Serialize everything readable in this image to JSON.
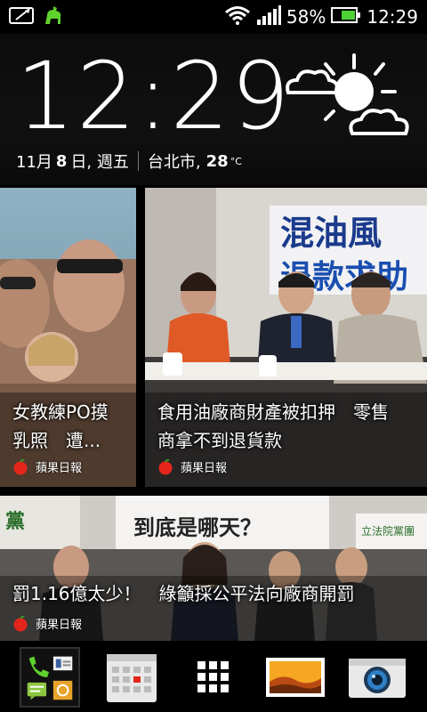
{
  "status_bar": {
    "battery_percent": "58%",
    "time": "12:29",
    "icons": [
      "photo-edit-icon",
      "android-mascot-icon",
      "wifi-icon",
      "signal-icon",
      "battery-icon"
    ]
  },
  "clock_widget": {
    "time": "12:29",
    "date_month": "11月",
    "date_day": "8",
    "date_suffix": "日, 週五",
    "city": "台北市,",
    "temperature": "28",
    "temp_unit": "°C",
    "weather_icon": "partly-sunny-cloudy-icon"
  },
  "news": {
    "tiles": [
      {
        "headline_line1": "女教練PO摸",
        "headline_line2": "乳照　遭...",
        "source": "蘋果日報"
      },
      {
        "headline_line1": "食用油廠商財產被扣押　零售",
        "headline_line2": "商拿不到退貨款",
        "source": "蘋果日報"
      },
      {
        "headline_line1": "罰1.16億太少！　綠籲採公平法向廠商開罰",
        "headline_line2": "",
        "source": "蘋果日報"
      }
    ],
    "photo_text": {
      "banner_line1": "混油風",
      "banner_line2": "退款求助",
      "banner_bottom": "到底是哪天？",
      "banner_side": "立法院黨團",
      "banner_left": "黨"
    }
  },
  "dock": {
    "items": [
      "people-messages-folder-icon",
      "calendar-icon",
      "all-apps-icon",
      "gallery-icon",
      "camera-icon"
    ]
  },
  "colors": {
    "accent_green": "#5fd12c",
    "battery_green": "#4cd137",
    "apple_red": "#e3261b"
  }
}
